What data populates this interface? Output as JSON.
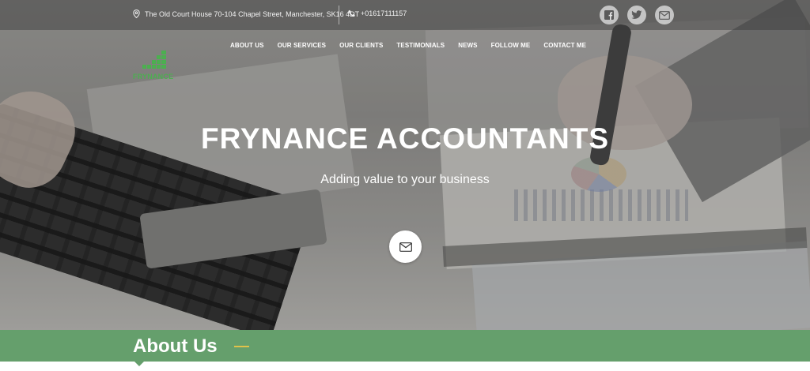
{
  "topbar": {
    "address": "The Old Court House 70-104 Chapel Street, Manchester, SK16 4DT",
    "phone": "+01617111157",
    "social_icons": [
      "facebook-icon",
      "twitter-icon",
      "mail-icon"
    ]
  },
  "nav": {
    "items": [
      "ABOUT US",
      "OUR SERVICES",
      "OUR CLIENTS",
      "TESTIMONIALS",
      "NEWS",
      "FOLLOW ME",
      "CONTACT ME"
    ]
  },
  "logo": {
    "text": "FRYNANCE",
    "color": "#4caf50"
  },
  "hero": {
    "title": "FRYNANCE ACCOUNTANTS",
    "subtitle": "Adding value to your business",
    "cta_icon": "mail-icon"
  },
  "about": {
    "title": "About Us",
    "bar_color": "#659f6c",
    "accent_color": "#e0c24a"
  }
}
